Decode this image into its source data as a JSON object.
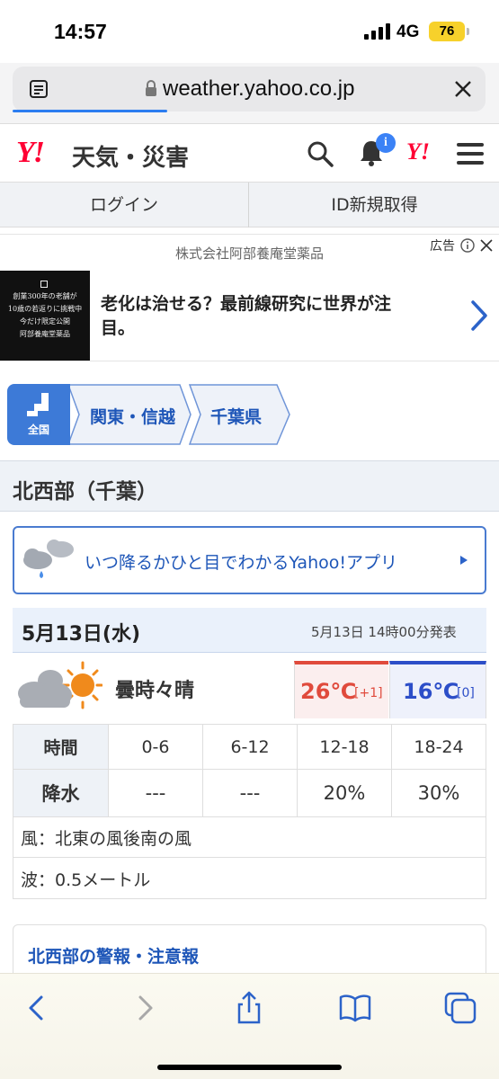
{
  "status": {
    "time": "14:57",
    "network": "4G",
    "battery": "76"
  },
  "browser": {
    "url": "weather.yahoo.co.jp"
  },
  "header": {
    "logo_y": "Y!",
    "logo_text": "天気・災害",
    "badge": "i",
    "yahoo_mark": "Y!"
  },
  "auth": {
    "login": "ログイン",
    "register": "ID新規取得"
  },
  "ad": {
    "label": "広告",
    "sponsor": "株式会社阿部養庵堂薬品",
    "image_lines": [
      "創業300年の老舗が",
      "10歳の若返りに挑戦中",
      "今だけ限定公開",
      "阿部養庵堂薬品"
    ],
    "headline": "老化は治せる？最前線研究に世界が注目。"
  },
  "breadcrumb": {
    "home": "全国",
    "items": [
      "関東・信越",
      "千葉県"
    ]
  },
  "region": {
    "title": "北西部（千葉）"
  },
  "app_promo": {
    "text": "いつ降るかひと目でわかるYahoo!アプリ"
  },
  "forecast": {
    "date": "5月13日(水)",
    "issued": "5月13日 14時00分発表",
    "weather": "曇時々晴",
    "high": "26℃",
    "high_diff": "[+1]",
    "low": "16℃",
    "low_diff": "[0]",
    "table": {
      "time_label": "時間",
      "precip_label": "降水",
      "periods": [
        "0-6",
        "6-12",
        "12-18",
        "18-24"
      ],
      "precip": [
        "---",
        "---",
        "20%",
        "30%"
      ]
    },
    "wind": "風：北東の風後南の風",
    "wave": "波：0.5メートル"
  },
  "warnings": {
    "title": "北西部の警報・注意報"
  },
  "colors": {
    "accent": "#3d7ad7",
    "link": "#1e56b8",
    "yahoo_red": "#ff0033",
    "high_temp": "#e04a3c",
    "low_temp": "#2c4ec8"
  }
}
